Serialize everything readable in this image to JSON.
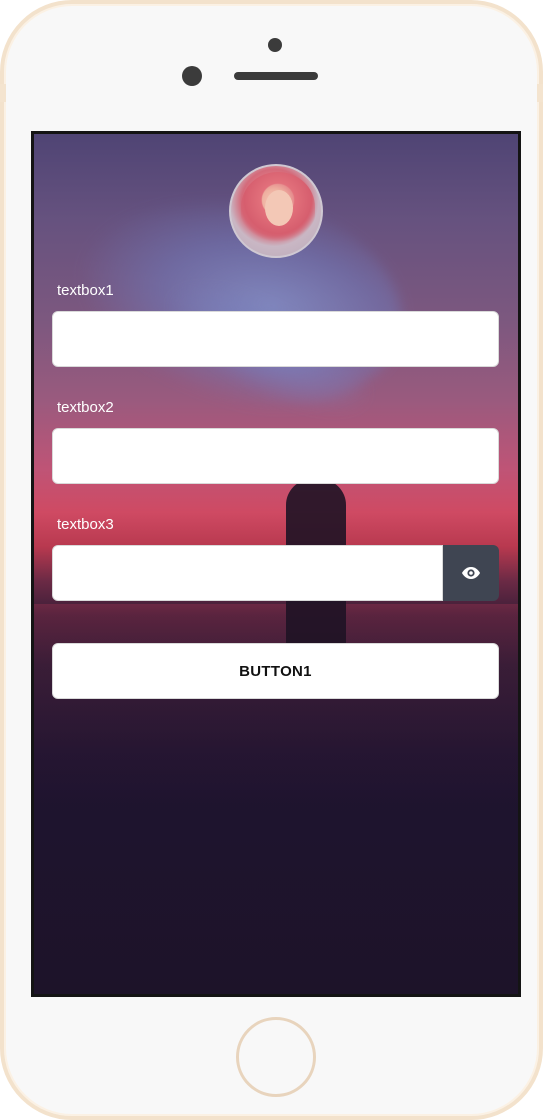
{
  "form": {
    "field1": {
      "label": "textbox1",
      "value": "",
      "placeholder": ""
    },
    "field2": {
      "label": "textbox2",
      "value": "",
      "placeholder": ""
    },
    "field3": {
      "label": "textbox3",
      "value": "",
      "placeholder": ""
    },
    "toggle_icon": "eye-icon",
    "button_label": "BUTTON1"
  },
  "colors": {
    "screen_background": "#1d1329",
    "toggle_background": "#3f4552",
    "input_background": "#ffffff",
    "label_color": "#ffffff",
    "phone_frame": "#f3e2cc"
  }
}
